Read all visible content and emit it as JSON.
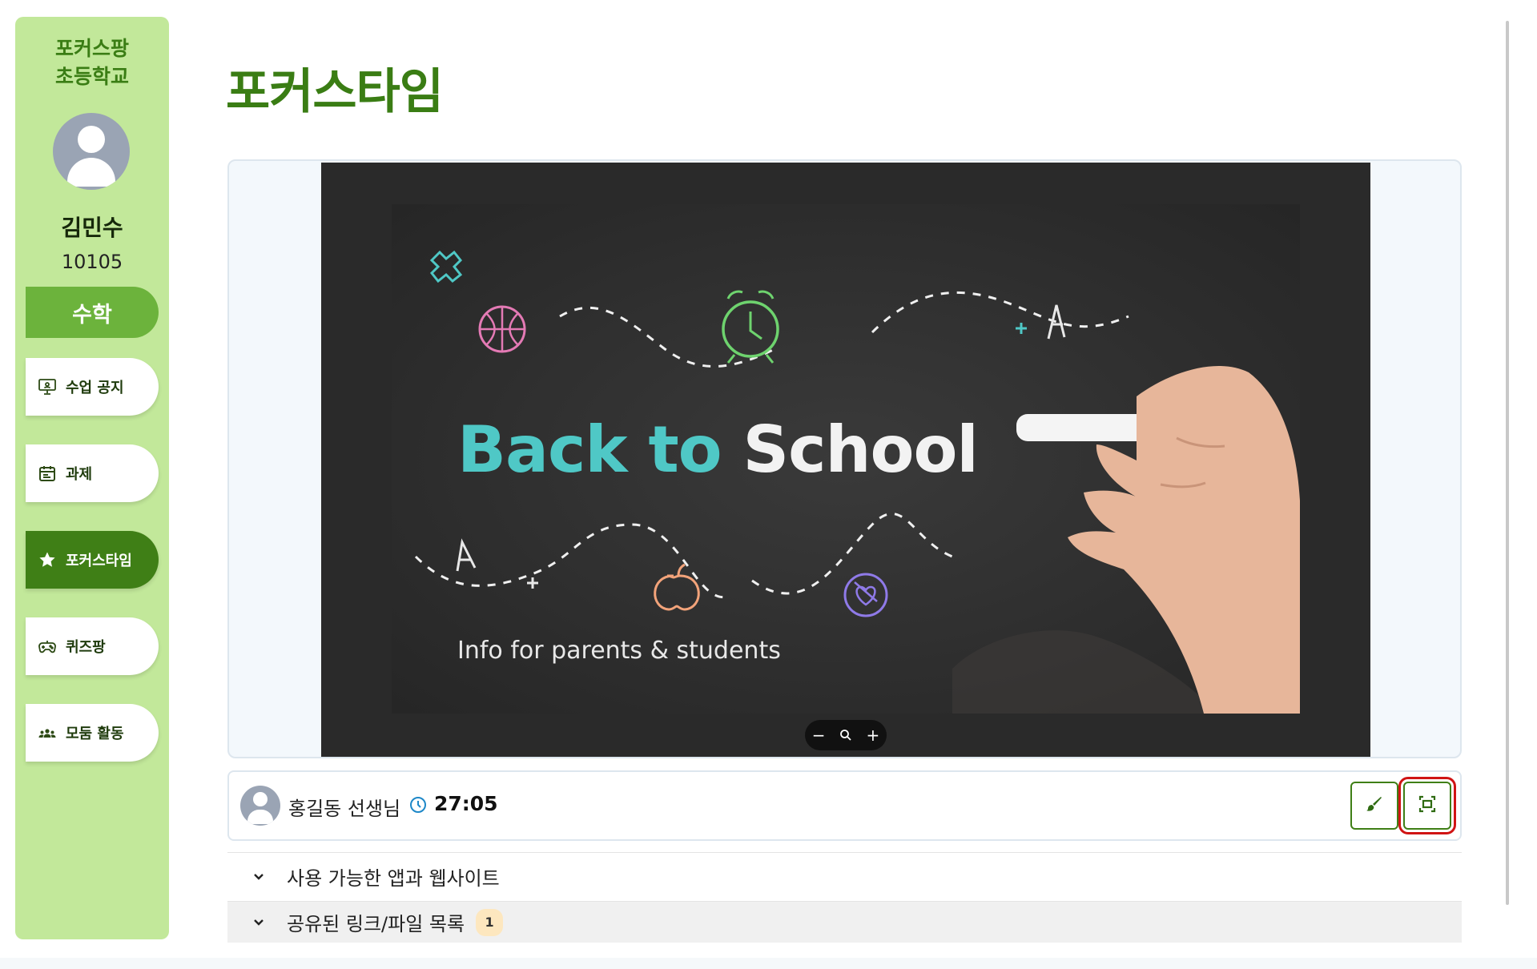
{
  "sidebar": {
    "school": "포커스팡\n초등학교",
    "student_name": "김민수",
    "student_id": "10105",
    "subject": "수학",
    "items": [
      {
        "label": "수업 공지",
        "icon": "presentation-board-icon"
      },
      {
        "label": "과제",
        "icon": "calendar-icon"
      },
      {
        "label": "포커스타임",
        "icon": "star-icon",
        "active": true
      },
      {
        "label": "퀴즈팡",
        "icon": "gamepad-icon"
      },
      {
        "label": "모둠 활동",
        "icon": "group-icon"
      }
    ]
  },
  "main": {
    "title": "포커스타임",
    "slide": {
      "title_part1": "Back to ",
      "title_part2": "School",
      "subtitle": "Info for parents & students"
    },
    "zoom_controls": {
      "minus": "−",
      "plus": "+"
    },
    "teacher": {
      "name": "홍길동 선생님",
      "timer": "27:05"
    },
    "accordions": [
      {
        "label": "사용 가능한 앱과 웹사이트"
      },
      {
        "label": "공유된 링크/파일 목록",
        "count": "1"
      }
    ]
  },
  "colors": {
    "sidebar_bg": "#c2e89a",
    "brand_green": "#3a7d14",
    "active_nav": "#3f7f16",
    "subject_bg": "#6cb33c",
    "slide_teal": "#4fc8c6",
    "selected_outline": "#d01414"
  }
}
